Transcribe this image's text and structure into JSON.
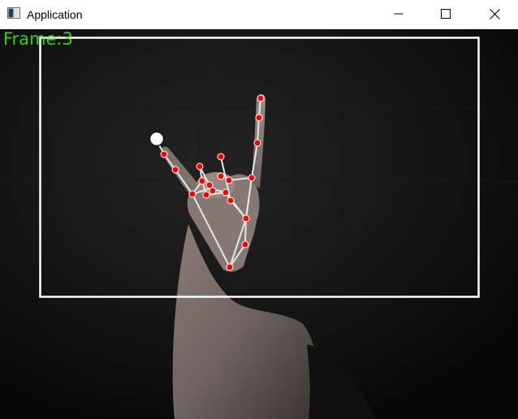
{
  "window": {
    "title": "Application",
    "icon": "app-window-icon",
    "controls": {
      "minimize_icon": "minimize-icon",
      "maximize_icon": "maximize-icon",
      "close_icon": "close-icon"
    }
  },
  "video": {
    "frame_label": "Frame:3",
    "frame_label_color": "#3aff2a",
    "roi_box_color": "#ffffff",
    "landmark_color": "#ff0000",
    "skeleton_color": "#e6e6e6"
  }
}
